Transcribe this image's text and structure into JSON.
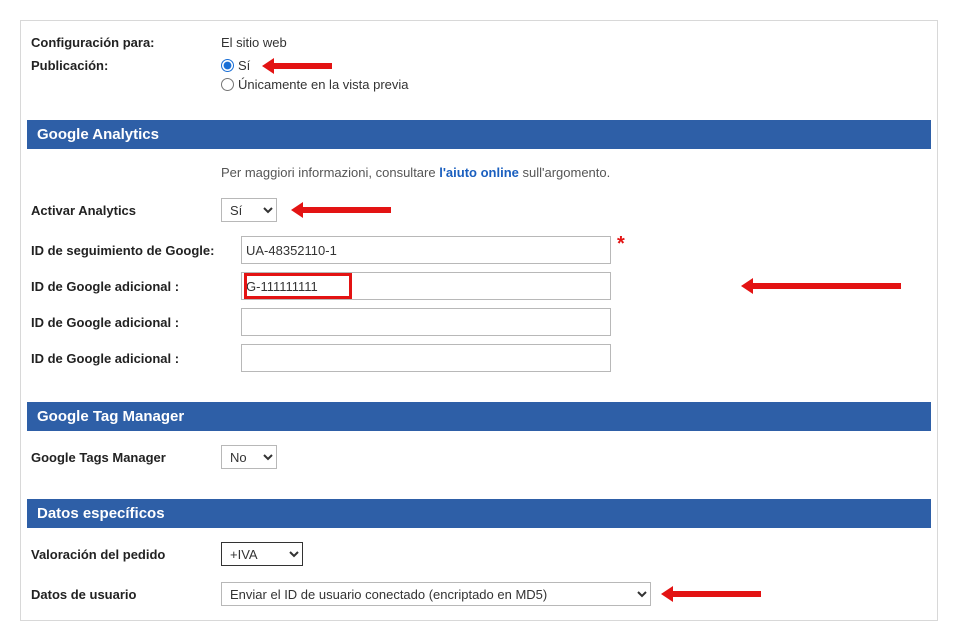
{
  "top": {
    "config_for_label": "Configuración para:",
    "config_for_value": "El sitio web",
    "publication_label": "Publicación:",
    "radio_yes": "Sí",
    "radio_preview": "Únicamente en la vista previa"
  },
  "ga": {
    "header": "Google Analytics",
    "info_prefix": "Per maggiori informazioni, consultare ",
    "info_link": "l'aiuto online",
    "info_suffix": " sull'argomento.",
    "activate_label": "Activar Analytics",
    "activate_value": "Sí",
    "tracking_id_label": "ID de seguimiento de Google:",
    "tracking_id_value": "UA-48352110-1",
    "extra_id_label": "ID de Google adicional :",
    "extra_id_value_1": "G-111111111",
    "extra_id_value_2": "",
    "extra_id_value_3": ""
  },
  "gtm": {
    "header": "Google Tag Manager",
    "label": "Google Tags Manager",
    "value": "No"
  },
  "datos": {
    "header": "Datos específicos",
    "order_label": "Valoración del pedido",
    "order_value": "+IVA",
    "user_label": "Datos de usuario",
    "user_value": "Enviar el ID de usuario conectado (encriptado en MD5)"
  }
}
